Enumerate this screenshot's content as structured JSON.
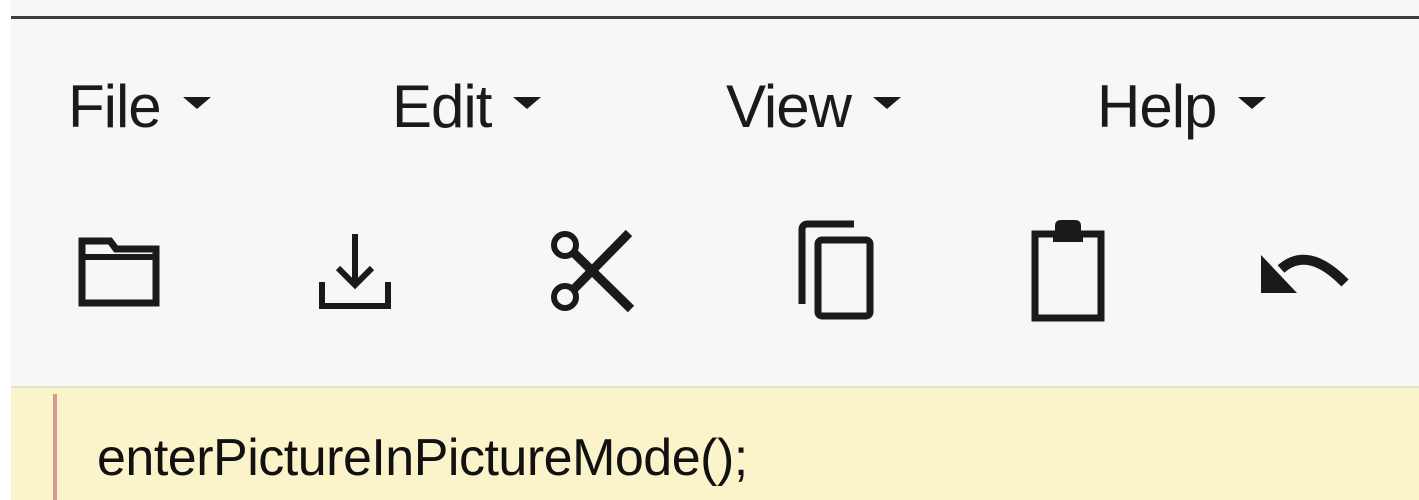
{
  "menubar": {
    "items": [
      {
        "label": "File",
        "icon": "caret-down-icon"
      },
      {
        "label": "Edit",
        "icon": "caret-down-icon"
      },
      {
        "label": "View",
        "icon": "caret-down-icon"
      },
      {
        "label": "Help",
        "icon": "caret-down-icon"
      }
    ]
  },
  "toolbar": {
    "tools": [
      {
        "name": "open",
        "icon": "folder-icon"
      },
      {
        "name": "save",
        "icon": "download-icon"
      },
      {
        "name": "cut",
        "icon": "scissors-icon"
      },
      {
        "name": "copy",
        "icon": "copy-icon"
      },
      {
        "name": "paste",
        "icon": "clipboard-icon"
      },
      {
        "name": "undo",
        "icon": "undo-icon"
      }
    ]
  },
  "editor": {
    "code_line": "enterPictureInPictureMode();"
  },
  "colors": {
    "background": "#f6f7f9",
    "highlight_line": "#fbf3c9",
    "gutter_marker": "#d49a8f",
    "text": "#1a1a1a"
  }
}
